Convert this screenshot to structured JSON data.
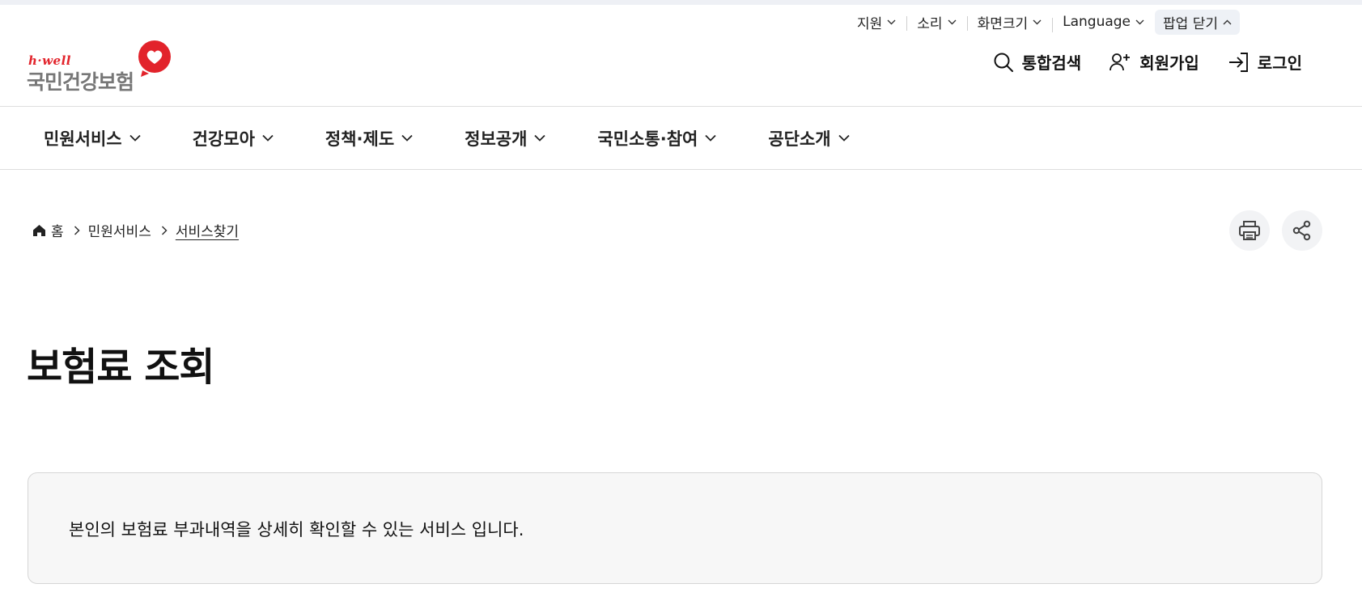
{
  "utility_bar": {
    "support": "지원",
    "sound": "소리",
    "screen_size": "화면크기",
    "language": "Language",
    "close_popup": "팝업 닫기"
  },
  "logo": {
    "brand": "h·well",
    "name": "국민건강보험"
  },
  "header_actions": {
    "search": "통합검색",
    "signup": "회원가입",
    "login": "로그인"
  },
  "gnb": {
    "items": [
      "민원서비스",
      "건강모아",
      "정책·제도",
      "정보공개",
      "국민소통·참여",
      "공단소개"
    ]
  },
  "breadcrumb": {
    "home": "홈",
    "level1": "민원서비스",
    "current": "서비스찾기"
  },
  "page": {
    "title": "보험료 조회",
    "description": "본인의 보험료 부과내역을 상세히 확인할 수 있는 서비스 입니다."
  },
  "colors": {
    "brand_red": "#e2232b",
    "logo_gray": "#777777",
    "box_bg": "#f7f7f7"
  }
}
